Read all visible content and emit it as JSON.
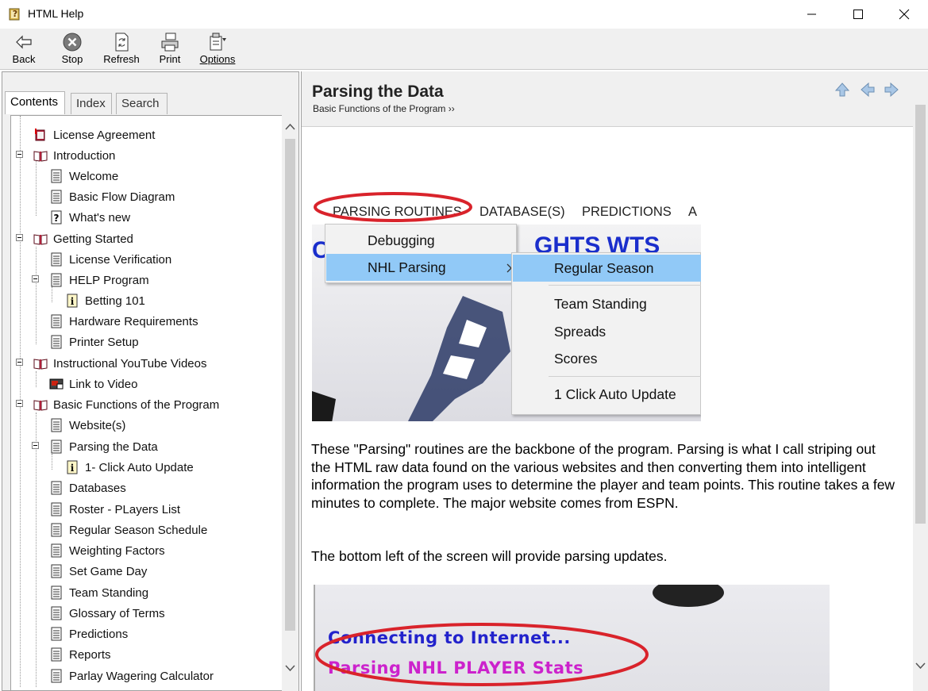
{
  "window": {
    "title": "HTML Help"
  },
  "toolbar": {
    "back": "Back",
    "stop": "Stop",
    "refresh": "Refresh",
    "print": "Print",
    "options": "Options"
  },
  "tabs": {
    "contents": "Contents",
    "index": "Index",
    "search": "Search"
  },
  "tree": [
    {
      "label": "License Agreement"
    },
    {
      "label": "Introduction"
    },
    {
      "label": "Welcome"
    },
    {
      "label": "Basic Flow Diagram"
    },
    {
      "label": "What's new"
    },
    {
      "label": "Getting Started"
    },
    {
      "label": "License Verification"
    },
    {
      "label": "HELP Program"
    },
    {
      "label": "Betting 101"
    },
    {
      "label": "Hardware Requirements"
    },
    {
      "label": "Printer Setup"
    },
    {
      "label": "Instructional YouTube Videos"
    },
    {
      "label": "Link to Video"
    },
    {
      "label": "Basic Functions of the Program"
    },
    {
      "label": "Website(s)"
    },
    {
      "label": "Parsing the Data"
    },
    {
      "label": "1- Click Auto Update"
    },
    {
      "label": "Databases"
    },
    {
      "label": "Roster - PLayers List"
    },
    {
      "label": "Regular Season Schedule"
    },
    {
      "label": "Weighting Factors"
    },
    {
      "label": "Set Game Day"
    },
    {
      "label": "Team Standing"
    },
    {
      "label": "Glossary of Terms"
    },
    {
      "label": "Predictions"
    },
    {
      "label": "Reports"
    },
    {
      "label": "Parlay Wagering Calculator"
    }
  ],
  "page": {
    "title": "Parsing the Data",
    "breadcrumb": "Basic Functions of the Program ››",
    "para1": "These \"Parsing\" routines are the backbone of the program.  Parsing is what I call striping out the HTML raw data found on the various websites and then converting them into intelligent information the program uses to determine the player and team points.  This routine takes a few minutes to complete.  The major website comes from ESPN.",
    "para2": "The bottom left of the screen will provide parsing updates."
  },
  "shot1": {
    "menu": [
      "PARSING ROUTINES",
      "DATABASE(S)",
      "PREDICTIONS",
      "A"
    ],
    "dropdown1": [
      "Debugging",
      "NHL Parsing"
    ],
    "dropdown2": [
      "Regular Season",
      "Team Standing",
      "Spreads",
      "Scores",
      "1 Click Auto Update"
    ],
    "bg_text": "GHTS WTS",
    "bg_letter": "C"
  },
  "shot2": {
    "line1": "Connecting to Internet...",
    "line2": "Parsing NHL PLAYER Stats"
  },
  "colors": {
    "highlight_ellipse": "#d9232b",
    "menu_selected": "#91c9f7"
  }
}
